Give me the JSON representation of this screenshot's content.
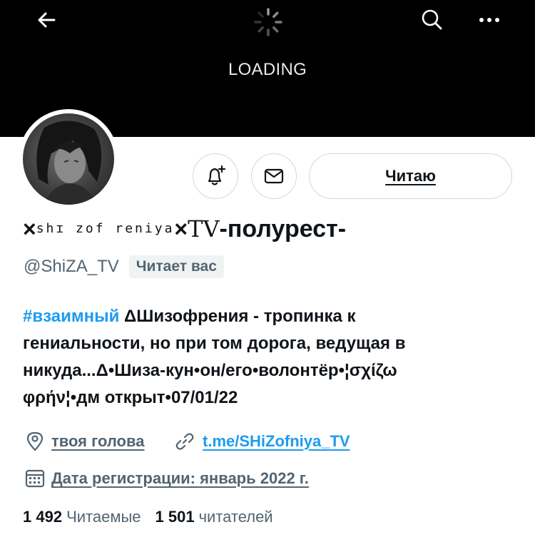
{
  "header": {
    "loading_text": "LOADING",
    "icons": [
      "arrow-left",
      "spinner",
      "search",
      "more-horizontal"
    ]
  },
  "actions": {
    "follow_label": "Читаю",
    "icons": [
      "bell-plus",
      "envelope"
    ]
  },
  "profile": {
    "name_x1": "×",
    "name_small": "shɪ zof reniya",
    "name_x2": "×",
    "name_tv": "TV",
    "name_main": " -полурест-",
    "handle": "@ShiZA_TV",
    "follows_you": "Читает вас",
    "bio": {
      "hashtag": "#взаимный",
      "line1_rest": " ΔШизофрения - тропинка к",
      "line2": "гениальности, но при том дорога, ведущая в",
      "line3": "никуда...Δ•Шиза-кун•он/его•волонтёр•¦σχίζω",
      "line4": "φρήν¦•дм открыт•07/01/22"
    },
    "location": "твоя голова",
    "url": "t.me/SHiZofniya_TV",
    "joined": "Дата регистрации: январь 2022 г."
  },
  "stats": {
    "following_count": "1 492",
    "following_label": "Читаемые",
    "followers_count": "1 501",
    "followers_label": "читателей"
  },
  "colors": {
    "accent": "#1d9bf0",
    "secondary_text": "#536471",
    "banner": "#000000"
  }
}
